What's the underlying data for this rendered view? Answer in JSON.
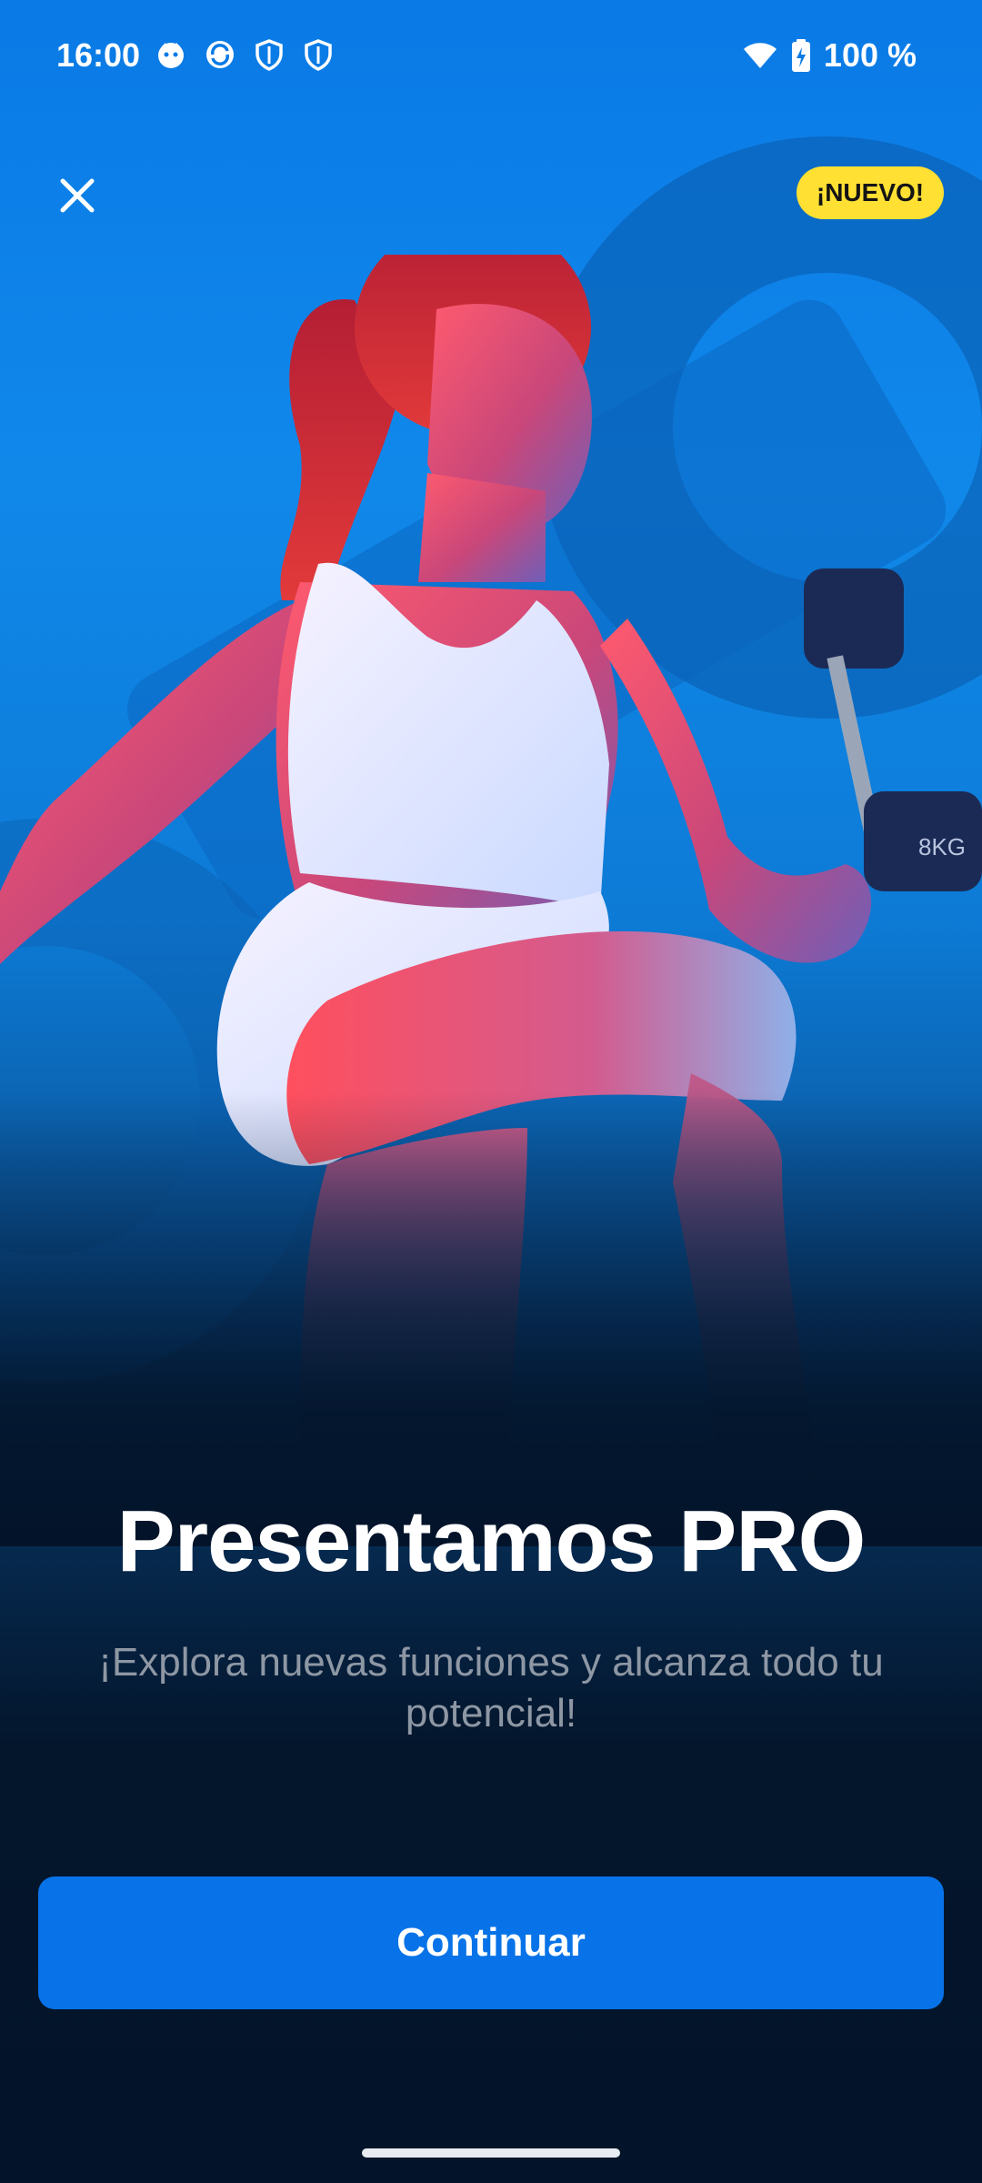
{
  "status_bar": {
    "time": "16:00",
    "battery": "100 %",
    "left_icons": [
      "cat-notification-icon",
      "sync-icon",
      "shield-icon",
      "shield-icon"
    ],
    "right_icons": [
      "wifi-icon",
      "battery-charging-icon"
    ]
  },
  "header": {
    "badge": "¡NUEVO!",
    "close_icon": "close-icon"
  },
  "content": {
    "title": "Presentamos PRO",
    "subtitle": "¡Explora nuevas funciones y alcanza todo tu potencial!"
  },
  "actions": {
    "continue_label": "Continuar"
  },
  "colors": {
    "primary": "#0873E8",
    "badge": "#FFE033",
    "background_top": "#0A7AE6",
    "background_bottom": "#03142A"
  }
}
